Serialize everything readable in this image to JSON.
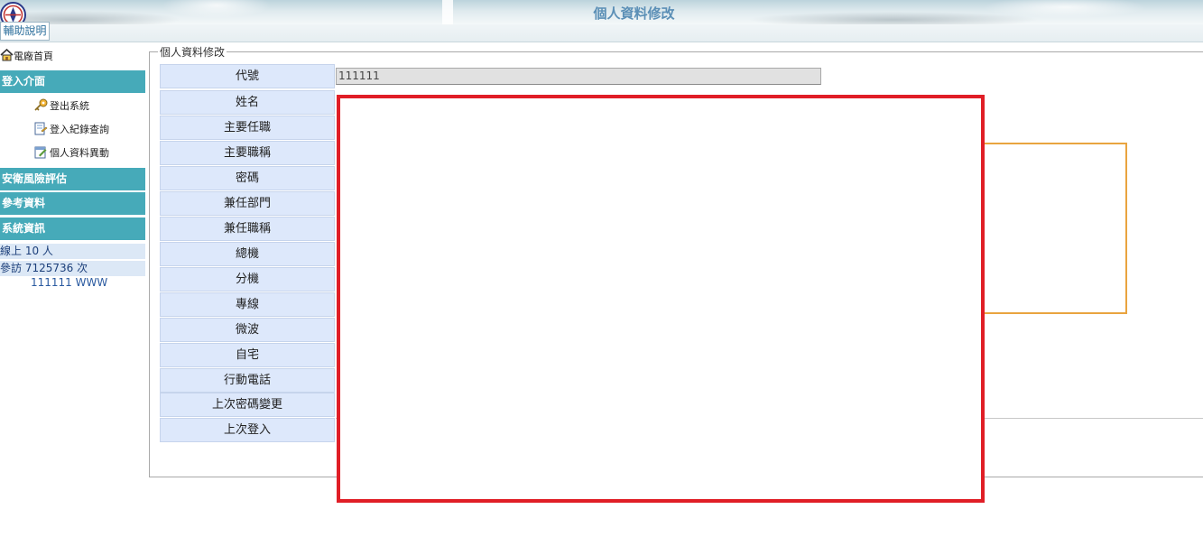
{
  "header": {
    "title": "個人資料修改"
  },
  "help_button": {
    "label": "輔助說明"
  },
  "sidebar": {
    "home_label": "電廠首頁",
    "sections": [
      {
        "label": "登入介面"
      },
      {
        "label": "安衛風險評估"
      },
      {
        "label": "參考資料"
      },
      {
        "label": "系統資訊"
      }
    ],
    "login_items": [
      {
        "label": "登出系統",
        "icon": "key-icon"
      },
      {
        "label": "登入紀錄查詢",
        "icon": "log-icon"
      },
      {
        "label": "個人資料異動",
        "icon": "edit-icon"
      }
    ],
    "online": "線上 10 人",
    "visits": "參訪 7125736 次",
    "user": "111111 WWW"
  },
  "form": {
    "legend": "個人資料修改",
    "code_value": "111111",
    "labels": [
      "代號",
      "姓名",
      "主要任職",
      "主要職稱",
      "密碼",
      "兼任部門",
      "兼任職稱",
      "總機",
      "分機",
      "專線",
      "微波",
      "自宅",
      "行動電話",
      "上次密碼變更",
      "上次登入"
    ]
  },
  "colors": {
    "sidebar_header": "#46aab9",
    "label_bg": "#dde8fb",
    "title_text": "#5b8fb6",
    "highlight_red": "#e01e26",
    "highlight_orange": "#e9a43f"
  }
}
